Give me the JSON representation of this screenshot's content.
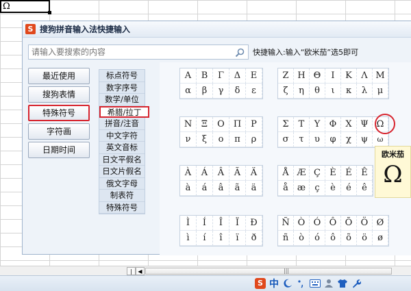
{
  "sheet": {
    "cell_value": "Ω"
  },
  "popup": {
    "title": "搜狗拼音输入法快捷输入",
    "search": {
      "placeholder": "请输入要搜索的内容",
      "value": ""
    },
    "hint": "快捷输入:输入“欧米茄”选5即可",
    "nav": [
      "最近使用",
      "搜狗表情",
      "特殊符号",
      "字符画",
      "日期时间"
    ],
    "nav_active_index": 2,
    "categories": [
      "标点符号",
      "数字序号",
      "数学/单位",
      "希腊/拉丁",
      "拼音/注音",
      "中文字符",
      "英文音标",
      "日文平假名",
      "日文片假名",
      "俄文字母",
      "制表符",
      "特殊符号"
    ],
    "category_active_index": 3,
    "symbol_groups": [
      {
        "rows": [
          [
            "Α",
            "Β",
            "Γ",
            "Δ",
            "Ε",
            ""
          ],
          [
            "α",
            "β",
            "γ",
            "δ",
            "ε",
            ""
          ]
        ]
      },
      {
        "rows": [
          [
            "Ζ",
            "Η",
            "Θ",
            "Ι",
            "Κ",
            "Λ",
            "Μ"
          ],
          [
            "ζ",
            "η",
            "θ",
            "ι",
            "κ",
            "λ",
            "μ"
          ]
        ]
      },
      {
        "rows": [
          [
            "Ν",
            "Ξ",
            "Ο",
            "Π",
            "Ρ",
            ""
          ],
          [
            "ν",
            "ξ",
            "ο",
            "π",
            "ρ",
            ""
          ]
        ]
      },
      {
        "rows": [
          [
            "Σ",
            "Τ",
            "Υ",
            "Φ",
            "Χ",
            "Ψ",
            "Ω"
          ],
          [
            "σ",
            "τ",
            "υ",
            "φ",
            "χ",
            "ψ",
            "ω"
          ]
        ]
      },
      {
        "rows": [
          [
            "À",
            "Á",
            "Â",
            "Ã",
            "Ä",
            ""
          ],
          [
            "à",
            "á",
            "â",
            "ã",
            "ä",
            ""
          ]
        ]
      },
      {
        "rows": [
          [
            "Å",
            "Æ",
            "Ç",
            "È",
            "É",
            "Ê",
            ""
          ],
          [
            "å",
            "æ",
            "ç",
            "è",
            "é",
            "ê",
            ""
          ]
        ]
      },
      {
        "rows": [
          [
            "Ì",
            "Í",
            "Î",
            "Ï",
            "Ð",
            ""
          ],
          [
            "ì",
            "í",
            "î",
            "ï",
            "ð",
            ""
          ]
        ]
      },
      {
        "rows": [
          [
            "Ñ",
            "Ò",
            "Ó",
            "Ô",
            "Õ",
            "Ö",
            "Ø"
          ],
          [
            "ñ",
            "ò",
            "ó",
            "ô",
            "õ",
            "ö",
            "ø"
          ]
        ]
      }
    ],
    "preview": {
      "name": "欧米茄",
      "glyph": "Ω"
    }
  },
  "colors": {
    "highlight": "#d7242e",
    "logo": "#e0481c"
  }
}
